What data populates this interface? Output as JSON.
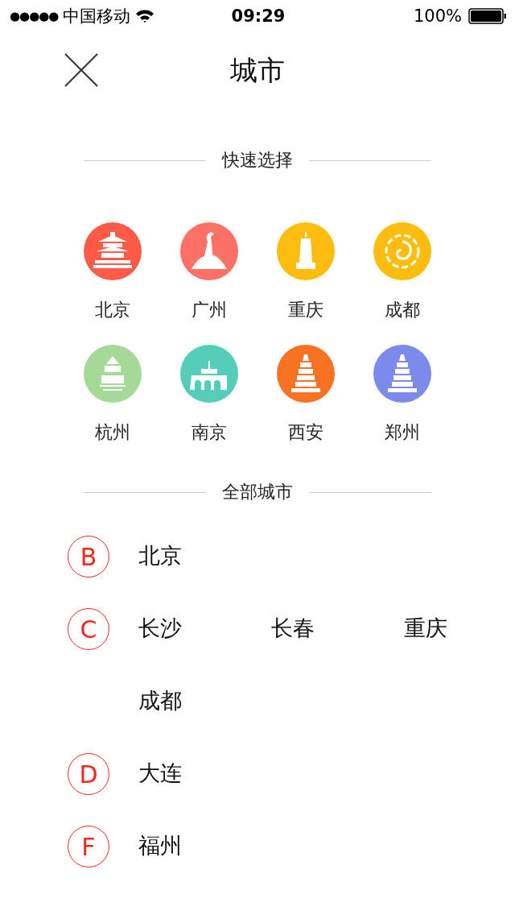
{
  "status_bar": {
    "signal_dots": "●●●●●",
    "carrier": "中国移动",
    "time": "09:29",
    "battery": "100%"
  },
  "header": {
    "title": "城市"
  },
  "quick_select": {
    "heading": "快速选择",
    "cities": [
      {
        "name": "北京",
        "color": "#fe5a48",
        "kind": "temple"
      },
      {
        "name": "广州",
        "color": "#fd7065",
        "kind": "statue"
      },
      {
        "name": "重庆",
        "color": "#fdbd10",
        "kind": "tower"
      },
      {
        "name": "成都",
        "color": "#fdbd10",
        "kind": "swirl"
      },
      {
        "name": "杭州",
        "color": "#a5d997",
        "kind": "pavilion"
      },
      {
        "name": "南京",
        "color": "#54cdb9",
        "kind": "gate"
      },
      {
        "name": "西安",
        "color": "#f87224",
        "kind": "pagoda"
      },
      {
        "name": "郑州",
        "color": "#7b8aeb",
        "kind": "pagoda"
      }
    ]
  },
  "all_cities": {
    "heading": "全部城市",
    "groups": [
      {
        "letter": "B",
        "cities": [
          "北京"
        ]
      },
      {
        "letter": "C",
        "cities": [
          "长沙",
          "长春",
          "重庆",
          "成都"
        ]
      },
      {
        "letter": "D",
        "cities": [
          "大连"
        ]
      },
      {
        "letter": "F",
        "cities": [
          "福州"
        ]
      }
    ]
  }
}
